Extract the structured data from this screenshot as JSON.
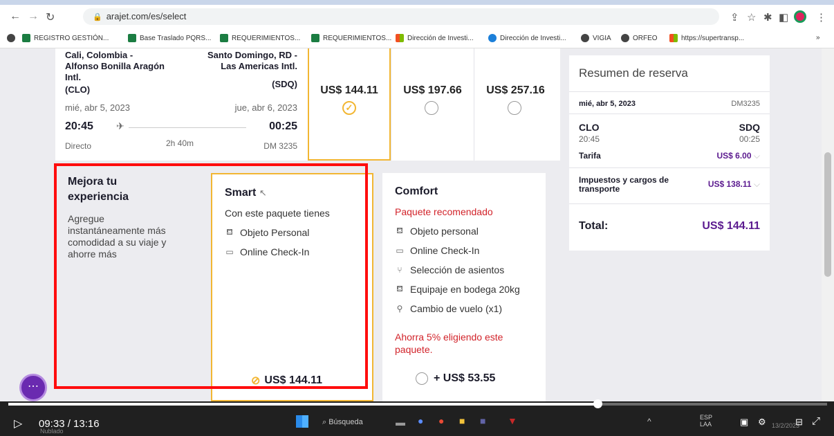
{
  "browser": {
    "url": "arajet.com/es/select",
    "bookmarks": [
      "REGISTRO GESTIÓN...",
      "Base Traslado PQRS...",
      "REQUERIMIENTOS...",
      "REQUERIMIENTOS...",
      "Dirección de Investi...",
      "Dirección de Investi...",
      "VIGIA",
      "ORFEO",
      "https://supertransp..."
    ],
    "overflow": "»"
  },
  "flight": {
    "origin_city": "Cali, Colombia -",
    "origin_airport": "Alfonso Bonilla Aragón",
    "origin_airport2": "Intl.",
    "origin_code": "(CLO)",
    "dest_city": "Santo Domingo, RD -",
    "dest_airport": "Las Americas Intl.",
    "dest_code": "(SDQ)",
    "depart_date": "mié, abr 5, 2023",
    "arrive_date": "jue, abr 6, 2023",
    "depart_time": "20:45",
    "arrive_time": "00:25",
    "type": "Directo",
    "duration": "2h 40m",
    "flight_no": "DM 3235",
    "fares": [
      "US$ 144.11",
      "US$ 197.66",
      "US$ 257.16"
    ]
  },
  "resumen": {
    "title": "Resumen de reserva",
    "date": "mié, abr 5, 2023",
    "flight": "DM3235",
    "origin": "CLO",
    "dest": "SDQ",
    "depart": "20:45",
    "arrive": "00:25",
    "tarifa_label": "Tarifa",
    "tarifa_value": "US$ 6.00",
    "impuestos_label1": "Impuestos y cargos de",
    "impuestos_label2": "transporte",
    "impuestos_value": "US$ 138.11",
    "total_label": "Total:",
    "total_value": "US$ 144.11"
  },
  "mejora": {
    "title1": "Mejora tu",
    "title2": "experiencia",
    "desc1": "Agregue",
    "desc2": "instantáneamente más",
    "desc3": "comodidad a su viaje y",
    "desc4": "ahorre más"
  },
  "smart": {
    "title": "Smart",
    "subtitle": "Con este paquete tienes",
    "features": [
      "Objeto Personal",
      "Online Check-In"
    ],
    "price": "US$ 144.11"
  },
  "comfort": {
    "title": "Comfort",
    "recommended": "Paquete recomendado",
    "features": [
      "Objeto personal",
      "Online Check-In",
      "Selección de asientos",
      "Equipaje en bodega 20kg",
      "Cambio de vuelo (x1)"
    ],
    "save1": "Ahorra 5% eligiendo este",
    "save2": "paquete.",
    "price": "+ US$ 53.55"
  },
  "video": {
    "time": "09:33 / 13:16",
    "progress": 0.72,
    "weather": "Nublado",
    "search": "Búsqueda",
    "lang1": "ESP",
    "lang2": "LAA",
    "date": "13/2/2023"
  },
  "colors": {
    "accent": "#f2b632",
    "brand": "#6a2ab0",
    "price_purple": "#5b1a8f",
    "red_note": "#d2232a",
    "annotation": "#ff0d0d"
  }
}
